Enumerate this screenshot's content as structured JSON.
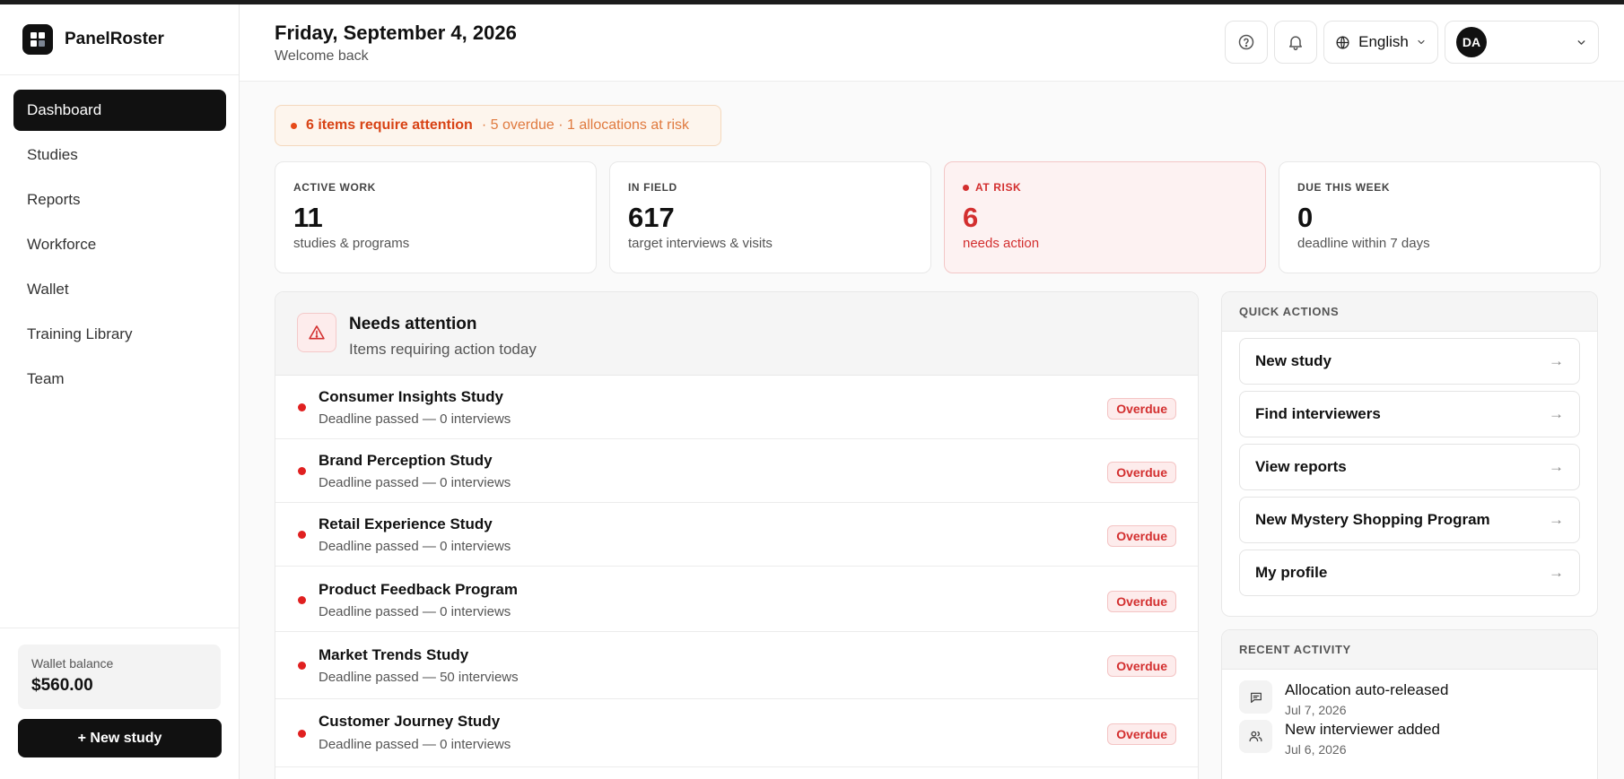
{
  "brand": {
    "name": "PanelRoster"
  },
  "sidebar": {
    "items": [
      {
        "label": "Dashboard",
        "active": true
      },
      {
        "label": "Studies"
      },
      {
        "label": "Reports"
      },
      {
        "label": "Workforce"
      },
      {
        "label": "Wallet"
      },
      {
        "label": "Training Library"
      },
      {
        "label": "Team"
      }
    ],
    "wallet_label": "Wallet balance",
    "wallet_value": "$560.00",
    "new_study_label": "+ New study"
  },
  "header": {
    "title": "Friday, September 4, 2026",
    "subtitle": "Welcome back",
    "language": "English",
    "avatar_initials": "DA",
    "icons": {
      "help": "help-circle-icon",
      "notifications": "bell-icon",
      "language": "globe-icon",
      "dropdown": "chevron-down-icon"
    }
  },
  "alert": {
    "main": "6 items require attention",
    "rest": "· 5 overdue · 1 allocations at risk"
  },
  "stats": [
    {
      "label": "ACTIVE WORK",
      "value": "11",
      "desc": "studies & programs"
    },
    {
      "label": "IN FIELD",
      "value": "617",
      "desc": "target interviews & visits"
    },
    {
      "label": "AT RISK",
      "value": "6",
      "desc": "needs action",
      "accent": "#d32f2f"
    },
    {
      "label": "DUE THIS WEEK",
      "value": "0",
      "desc": "deadline within 7 days"
    }
  ],
  "attention": {
    "title": "Needs attention",
    "subtitle": "Items requiring action today",
    "rows": [
      {
        "title": "Consumer Insights Study",
        "sub": "Deadline passed — 0 interviews",
        "badge": "Overdue"
      },
      {
        "title": "Brand Perception Study",
        "sub": "Deadline passed — 0 interviews",
        "badge": "Overdue"
      },
      {
        "title": "Retail Experience Study",
        "sub": "Deadline passed — 0 interviews",
        "badge": "Overdue"
      },
      {
        "title": "Product Feedback Program",
        "sub": "Deadline passed — 0 interviews",
        "badge": "Overdue"
      },
      {
        "title": "Market Trends Study",
        "sub": "Deadline passed — 50 interviews",
        "badge": "Overdue"
      },
      {
        "title": "Customer Journey Study",
        "sub": "Deadline passed — 0 interviews",
        "badge": "Overdue"
      }
    ]
  },
  "quick_actions": {
    "title": "QUICK ACTIONS",
    "items": [
      {
        "label": "New study"
      },
      {
        "label": "Find interviewers"
      },
      {
        "label": "View reports"
      },
      {
        "label": "New Mystery Shopping Program"
      },
      {
        "label": "My profile"
      }
    ]
  },
  "recent_activity": {
    "title": "RECENT ACTIVITY",
    "items": [
      {
        "title": "Allocation auto-released",
        "date": "Jul 7, 2026",
        "icon": "message-square-icon"
      },
      {
        "title": "New interviewer added",
        "date": "Jul 6, 2026",
        "icon": "users-icon"
      }
    ]
  },
  "colors": {
    "accent": "#111111",
    "danger": "#d32f2f",
    "warning": "#d84315"
  }
}
